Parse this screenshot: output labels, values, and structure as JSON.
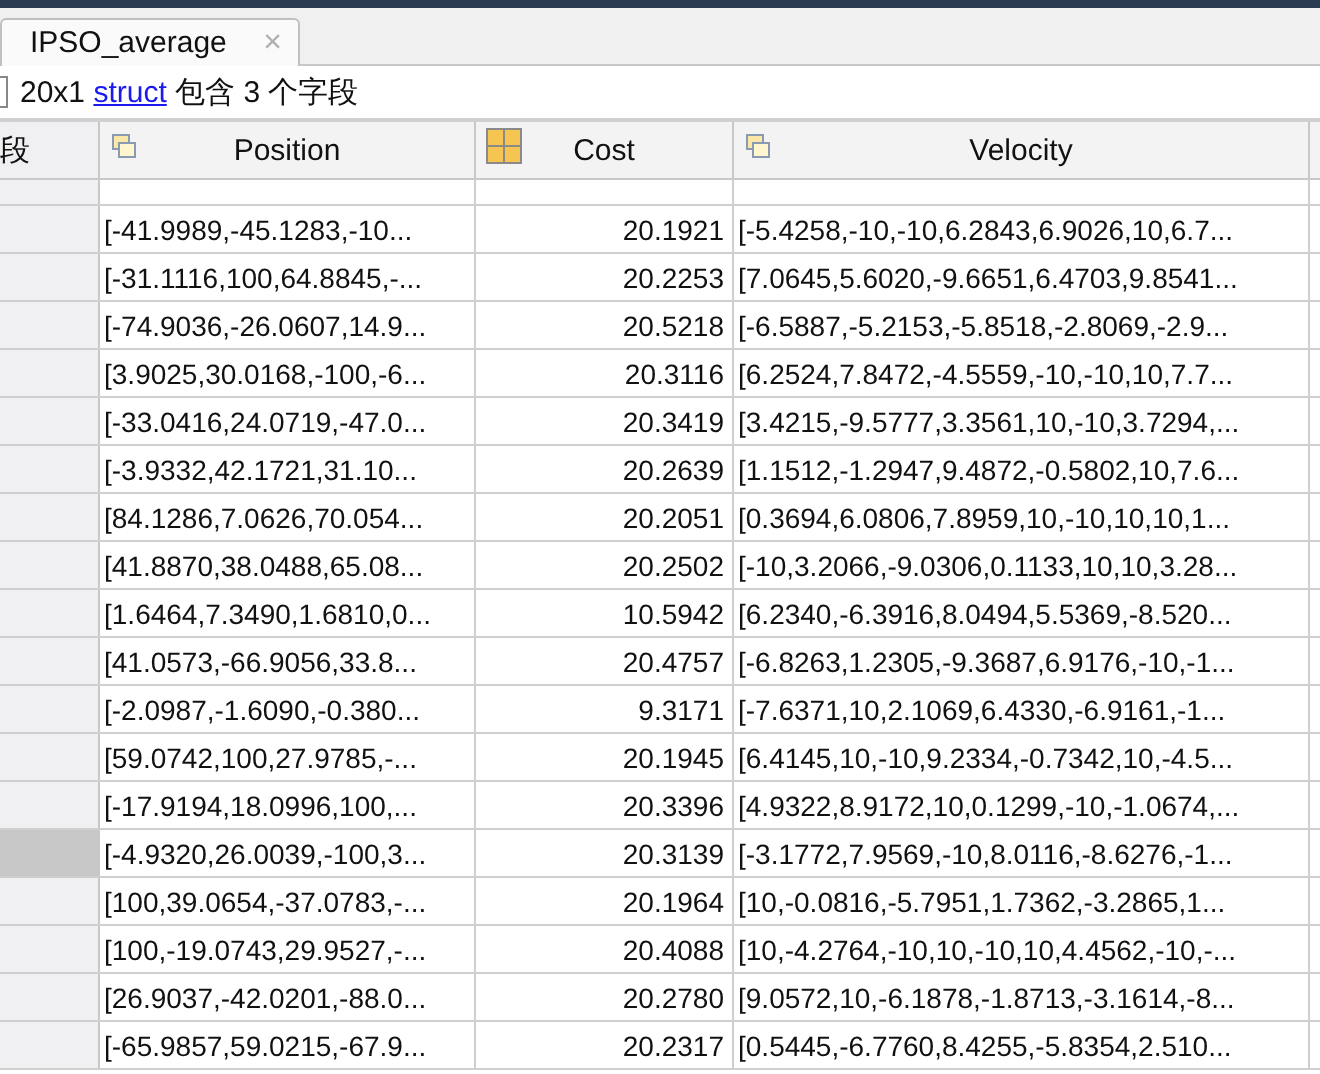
{
  "tab": {
    "title": "IPSO_average",
    "close": "×",
    "selected": true
  },
  "summary": {
    "size": "20x1",
    "class_link": "struct",
    "text": "包含 3 个字段"
  },
  "table": {
    "row_header": "段",
    "columns": [
      {
        "name": "Position",
        "kind": "struct"
      },
      {
        "name": "Cost",
        "kind": "double"
      },
      {
        "name": "Velocity",
        "kind": "struct"
      }
    ],
    "rows": [
      {
        "selected": false,
        "cells": [
          "[-41.9989,-45.1283,-10...",
          "20.1921",
          "[-5.4258,-10,-10,6.2843,6.9026,10,6.7..."
        ]
      },
      {
        "selected": false,
        "cells": [
          "[-31.1116,100,64.8845,-...",
          "20.2253",
          "[7.0645,5.6020,-9.6651,6.4703,9.8541..."
        ]
      },
      {
        "selected": false,
        "cells": [
          "[-74.9036,-26.0607,14.9...",
          "20.5218",
          "[-6.5887,-5.2153,-5.8518,-2.8069,-2.9..."
        ]
      },
      {
        "selected": false,
        "cells": [
          "[3.9025,30.0168,-100,-6...",
          "20.3116",
          "[6.2524,7.8472,-4.5559,-10,-10,10,7.7..."
        ]
      },
      {
        "selected": false,
        "cells": [
          "[-33.0416,24.0719,-47.0...",
          "20.3419",
          "[3.4215,-9.5777,3.3561,10,-10,3.7294,..."
        ]
      },
      {
        "selected": false,
        "cells": [
          "[-3.9332,42.1721,31.10...",
          "20.2639",
          "[1.1512,-1.2947,9.4872,-0.5802,10,7.6..."
        ]
      },
      {
        "selected": false,
        "cells": [
          "[84.1286,7.0626,70.054...",
          "20.2051",
          "[0.3694,6.0806,7.8959,10,-10,10,10,1..."
        ]
      },
      {
        "selected": false,
        "cells": [
          "[41.8870,38.0488,65.08...",
          "20.2502",
          "[-10,3.2066,-9.0306,0.1133,10,10,3.28..."
        ]
      },
      {
        "selected": false,
        "cells": [
          "[1.6464,7.3490,1.6810,0...",
          "10.5942",
          "[6.2340,-6.3916,8.0494,5.5369,-8.520..."
        ]
      },
      {
        "selected": false,
        "cells": [
          "[41.0573,-66.9056,33.8...",
          "20.4757",
          "[-6.8263,1.2305,-9.3687,6.9176,-10,-1..."
        ]
      },
      {
        "selected": false,
        "cells": [
          "[-2.0987,-1.6090,-0.380...",
          "9.3171",
          "[-7.6371,10,2.1069,6.4330,-6.9161,-1..."
        ]
      },
      {
        "selected": false,
        "cells": [
          "[59.0742,100,27.9785,-...",
          "20.1945",
          "[6.4145,10,-10,9.2334,-0.7342,10,-4.5..."
        ]
      },
      {
        "selected": false,
        "cells": [
          "[-17.9194,18.0996,100,...",
          "20.3396",
          "[4.9322,8.9172,10,0.1299,-10,-1.0674,..."
        ]
      },
      {
        "selected": true,
        "cells": [
          "[-4.9320,26.0039,-100,3...",
          "20.3139",
          "[-3.1772,7.9569,-10,8.0116,-8.6276,-1..."
        ]
      },
      {
        "selected": false,
        "cells": [
          "[100,39.0654,-37.0783,-...",
          "20.1964",
          "[10,-0.0816,-5.7951,1.7362,-3.2865,1..."
        ]
      },
      {
        "selected": false,
        "cells": [
          "[100,-19.0743,29.9527,-...",
          "20.4088",
          "[10,-4.2764,-10,10,-10,10,4.4562,-10,-..."
        ]
      },
      {
        "selected": false,
        "cells": [
          "[26.9037,-42.0201,-88.0...",
          "20.2780",
          "[9.0572,10,-6.1878,-1.8713,-3.1614,-8..."
        ]
      },
      {
        "selected": false,
        "cells": [
          "[-65.9857,59.0215,-67.9...",
          "20.2317",
          "[0.5445,-6.7760,8.4255,-5.8354,2.510..."
        ]
      }
    ]
  }
}
